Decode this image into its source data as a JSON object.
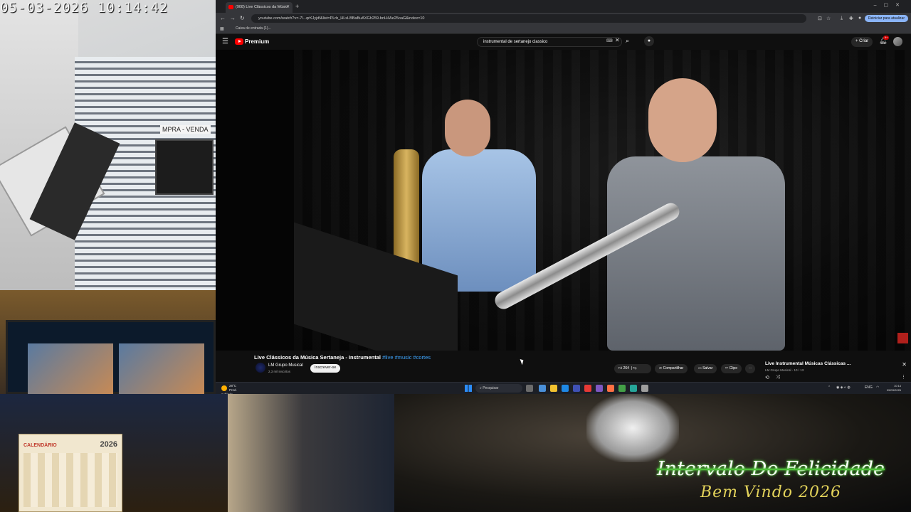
{
  "camera": {
    "timestamp": "05-03-2026  10:14:42",
    "shop_sign": "MPRA - VENDA"
  },
  "browser": {
    "tab_title": "(908) Live Clássicos da Músic",
    "url": "youtube.com/watch?v=-7l...qrKJyjdf&list=PLrb_HLxLBBaBuAXGh259-bnH4Ae25oaG&index=10",
    "sync_button": "Reiniciar para atualizar",
    "bookmark": "Caixa de entrada (1)..."
  },
  "youtube": {
    "brand": "Premium",
    "search_query": "instrumental de sertanejo classico",
    "create_label": "Criar",
    "notif_count": "9+",
    "video_title": "Live Clássicos da Música Sertaneja - Instrumental",
    "video_tags": "#live #music #cortes",
    "channel_name": "LM Grupo Musical",
    "channel_subs": "2,3 mil inscritos",
    "subscribe_label": "Inscrever-se",
    "like_count": "264",
    "share_label": "Compartilhar",
    "save_label": "Salvar",
    "clip_label": "Clipe",
    "playlist_title": "Live Instrumental Músicas Clássicas ...",
    "playlist_sub": "LM Grupo Musical - 10 / 13"
  },
  "taskbar": {
    "weather_temp": "28°C",
    "weather_desc": "Pred. nublado",
    "search_placeholder": "Pesquisar",
    "lang": "ENG",
    "time": "10:14",
    "date": "05/03/2026"
  },
  "desk": {
    "calendar_title": "CALENDÁRIO",
    "calendar_year": "2026"
  },
  "overlay": {
    "title": "Intervalo Do Felicidade",
    "subtitle": "Bem Vindo 2026"
  }
}
